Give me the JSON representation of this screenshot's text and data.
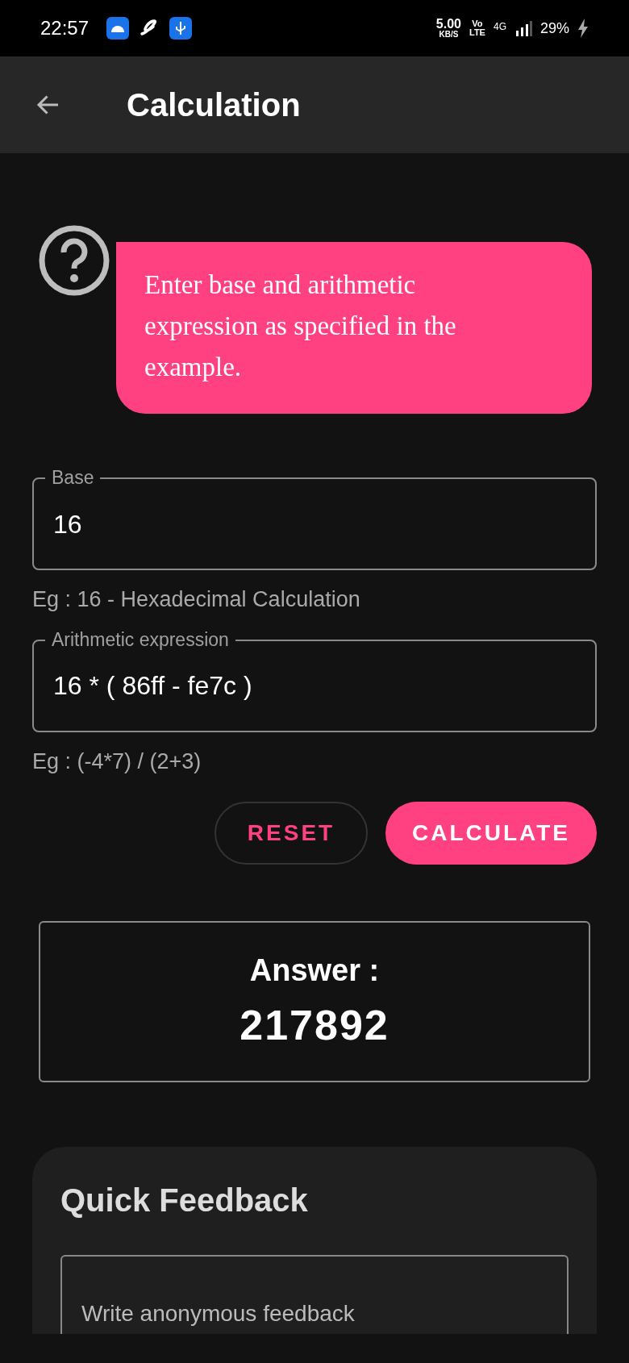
{
  "status_bar": {
    "time": "22:57",
    "net_speed": "5.00",
    "net_unit": "KB/S",
    "volte_top": "Vo",
    "volte_bottom": "LTE",
    "network": "4G",
    "battery": "29%"
  },
  "app_bar": {
    "title": "Calculation"
  },
  "hint": {
    "text": "Enter base and arithmetic expression as specified in the example."
  },
  "fields": [
    {
      "label": "Base",
      "value": "16",
      "helper": "Eg : 16 - Hexadecimal Calculation"
    },
    {
      "label": "Arithmetic expression",
      "value": "16 * ( 86ff - fe7c )",
      "helper": "Eg : (-4*7) / (2+3)"
    }
  ],
  "buttons": [
    {
      "label": "RESET",
      "kind": "outlined"
    },
    {
      "label": "CALCULATE",
      "kind": "filled"
    }
  ],
  "answer": {
    "label": "Answer :",
    "value": "217892"
  },
  "feedback": {
    "title": "Quick Feedback",
    "placeholder": "Write anonymous feedback"
  }
}
